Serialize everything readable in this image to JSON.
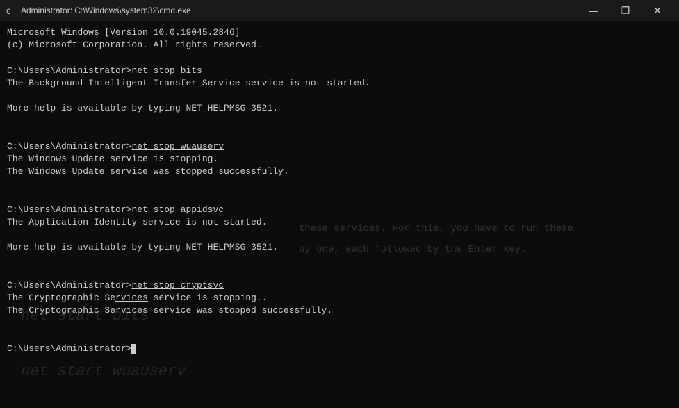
{
  "window": {
    "title": "Administrator: C:\\Windows\\system32\\cmd.exe",
    "icon": "⬛"
  },
  "controls": {
    "minimize": "—",
    "maximize": "❐",
    "close": "✕"
  },
  "terminal": {
    "lines": [
      {
        "type": "output",
        "text": "Microsoft Windows [Version 10.0.19045.2846]"
      },
      {
        "type": "output",
        "text": "(c) Microsoft Corporation. All rights reserved."
      },
      {
        "type": "blank"
      },
      {
        "type": "prompt",
        "user": "C:\\Users\\Administrator>",
        "command": "net stop bits"
      },
      {
        "type": "output",
        "text": "The Background Intelligent Transfer Service service is not started."
      },
      {
        "type": "blank"
      },
      {
        "type": "output",
        "text": "More help is available by typing NET HELPMSG 3521."
      },
      {
        "type": "blank"
      },
      {
        "type": "blank"
      },
      {
        "type": "prompt",
        "user": "C:\\Users\\Administrator>",
        "command": "net stop wuauserv"
      },
      {
        "type": "output",
        "text": "The Windows Update service is stopping."
      },
      {
        "type": "output",
        "text": "The Windows Update service was stopped successfully."
      },
      {
        "type": "blank"
      },
      {
        "type": "blank"
      },
      {
        "type": "prompt",
        "user": "C:\\Users\\Administrator>",
        "command": "net stop appidsvc"
      },
      {
        "type": "output",
        "text": "The Application Identity service is not started."
      },
      {
        "type": "blank"
      },
      {
        "type": "output",
        "text": "More help is available by typing NET HELPMSG 3521."
      },
      {
        "type": "blank"
      },
      {
        "type": "blank"
      },
      {
        "type": "prompt",
        "user": "C:\\Users\\Administrator>",
        "command": "net stop cryptsvc"
      },
      {
        "type": "output",
        "text": "The Cryptographic Services service is stopping.."
      },
      {
        "type": "output",
        "text": "The Cryptographic Services service was stopped successfully."
      },
      {
        "type": "blank"
      },
      {
        "type": "blank"
      },
      {
        "type": "prompt-only",
        "user": "C:\\Users\\Administrator>"
      }
    ],
    "overlay": {
      "line1": "these services. For this, you have to run these",
      "line2": "by one, each followed by the Enter key.",
      "net_start_bits": "net start bits",
      "net_start_wuauserv": "net start wuauserv"
    }
  }
}
